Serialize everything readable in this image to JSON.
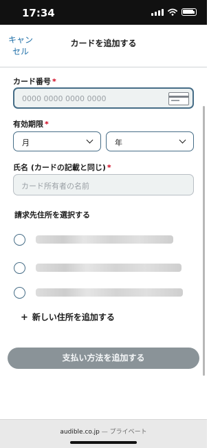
{
  "status_bar": {
    "time": "17:34"
  },
  "nav": {
    "cancel_label": "キャンセル",
    "cancel_line1": "キャン",
    "cancel_line2": "セル",
    "title": "カードを追加する"
  },
  "form": {
    "card_number": {
      "label": "カード番号",
      "required_mark": "*",
      "placeholder": "0000 0000 0000 0000"
    },
    "expiry": {
      "label": "有効期限",
      "required_mark": "*",
      "month_value": "月",
      "year_value": "年"
    },
    "name": {
      "label": "氏名 (カードの記載と同じ)",
      "required_mark": "*",
      "placeholder": "カード所有者の名前"
    }
  },
  "billing": {
    "title": "請求先住所を選択する",
    "add_new_label": "新しい住所を追加する",
    "add_new_icon": "+"
  },
  "submit_button_label": "支払い方法を追加する",
  "bottom_bar": {
    "domain": "audible.co.jp",
    "separator": "—",
    "mode": "プライベート"
  },
  "colors": {
    "accent": "#456c86",
    "required": "#d0021b",
    "button_disabled": "#8a9398",
    "link": "#1e6fa8"
  }
}
